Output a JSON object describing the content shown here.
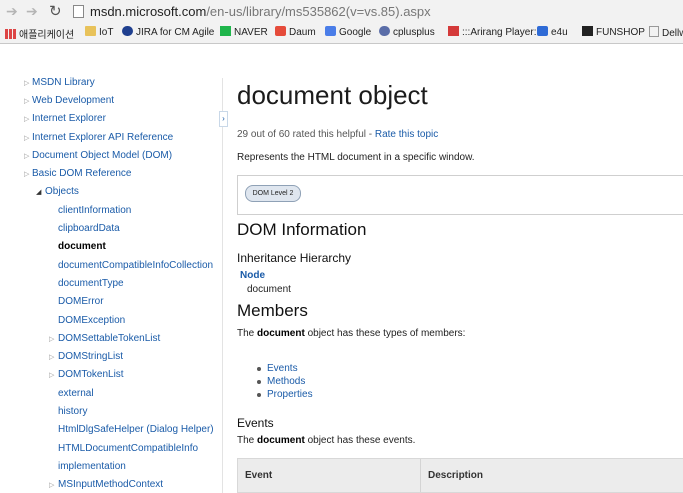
{
  "browser": {
    "url_host": "msdn.microsoft.com",
    "url_path": "/en-us/library/ms535862(v=vs.85).aspx",
    "bookmarks": [
      {
        "label": "애플리케이션",
        "icon": "apps-grid-icon"
      },
      {
        "label": "IoT",
        "icon": "folder-icon"
      },
      {
        "label": "JIRA for CM Agile",
        "icon": "jira-icon"
      },
      {
        "label": "NAVER",
        "icon": "naver-icon"
      },
      {
        "label": "Daum",
        "icon": "daum-icon"
      },
      {
        "label": "Google",
        "icon": "google-icon"
      },
      {
        "label": "cplusplus",
        "icon": "cplusplus-icon"
      },
      {
        "label": ":::Arirang Player:::",
        "icon": "arirang-icon"
      },
      {
        "label": "e4u",
        "icon": "e4u-icon"
      },
      {
        "label": "FUNSHOP",
        "icon": "funshop-icon"
      },
      {
        "label": "Dellw",
        "icon": "page-icon"
      }
    ]
  },
  "leftnav": {
    "items": [
      {
        "label": "MSDN Library"
      },
      {
        "label": "Web Development"
      },
      {
        "label": "Internet Explorer"
      },
      {
        "label": "Internet Explorer API Reference"
      },
      {
        "label": "Document Object Model (DOM)"
      },
      {
        "label": "Basic DOM Reference"
      },
      {
        "label": "Objects"
      },
      {
        "label": "clientInformation"
      },
      {
        "label": "clipboardData"
      },
      {
        "label": "document"
      },
      {
        "label": "documentCompatibleInfoCollection"
      },
      {
        "label": "documentType"
      },
      {
        "label": "DOMError"
      },
      {
        "label": "DOMException"
      },
      {
        "label": "DOMSettableTokenList"
      },
      {
        "label": "DOMStringList"
      },
      {
        "label": "DOMTokenList"
      },
      {
        "label": "external"
      },
      {
        "label": "history"
      },
      {
        "label": "HtmlDlgSafeHelper (Dialog Helper)"
      },
      {
        "label": "HTMLDocumentCompatibleInfo"
      },
      {
        "label": "implementation"
      },
      {
        "label": "MSInputMethodContext"
      }
    ]
  },
  "main": {
    "title": "document object",
    "rating_text": "29 out of 60 rated this helpful",
    "rating_sep": " - ",
    "rate_link": "Rate this topic",
    "description": "Represents the HTML document in a specific window.",
    "dom_level": "DOM Level 2",
    "dom_info_heading": "DOM Information",
    "inheritance_heading": "Inheritance Hierarchy",
    "node_link": "Node",
    "node_child": "document",
    "members_heading": "Members",
    "members_text": {
      "pre": "The ",
      "bold": "document",
      "post": " object has these types of members:"
    },
    "member_links": [
      "Events",
      "Methods",
      "Properties"
    ],
    "events_heading": "Events",
    "events_text": {
      "pre": "The ",
      "bold": "document",
      "post": " object has these events."
    },
    "table_headers": [
      "Event",
      "Description"
    ]
  }
}
